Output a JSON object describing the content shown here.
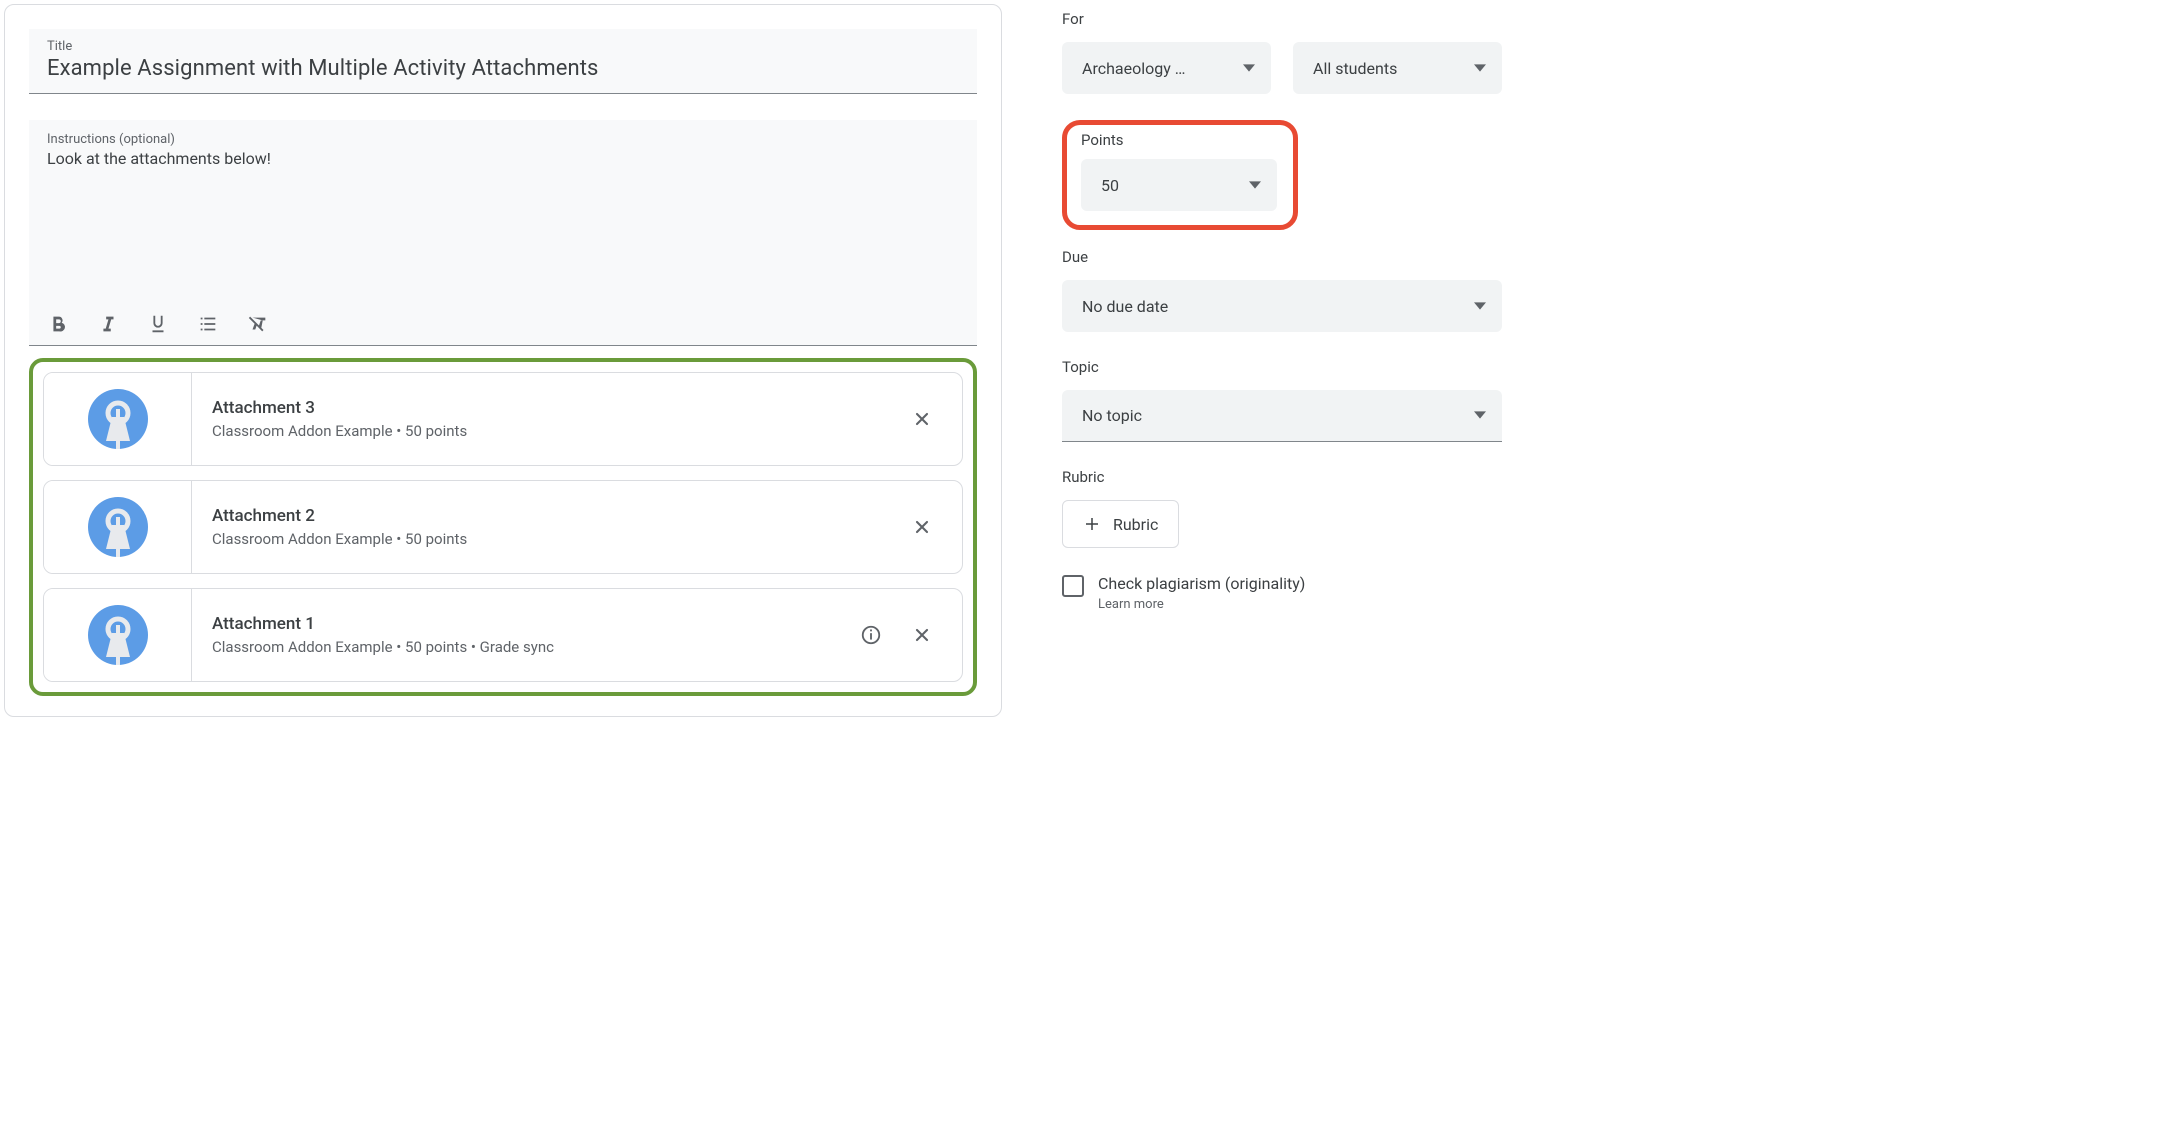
{
  "title_field": {
    "label": "Title",
    "value": "Example Assignment with Multiple Activity Attachments"
  },
  "instructions_field": {
    "label": "Instructions (optional)",
    "value": "Look at the attachments below!"
  },
  "attachments": [
    {
      "title": "Attachment 3",
      "subtitle": "Classroom Addon Example • 50 points",
      "has_info": false
    },
    {
      "title": "Attachment 2",
      "subtitle": "Classroom Addon Example • 50 points",
      "has_info": false
    },
    {
      "title": "Attachment 1",
      "subtitle": "Classroom Addon Example • 50 points • Grade sync",
      "has_info": true
    }
  ],
  "sidebar": {
    "for_label": "For",
    "class_selected": "Archaeology …",
    "students_selected": "All students",
    "points_label": "Points",
    "points_value": "50",
    "due_label": "Due",
    "due_value": "No due date",
    "topic_label": "Topic",
    "topic_value": "No topic",
    "rubric_label": "Rubric",
    "rubric_button": "Rubric",
    "plagiarism_label": "Check plagiarism (originality)",
    "learn_more": "Learn more"
  }
}
